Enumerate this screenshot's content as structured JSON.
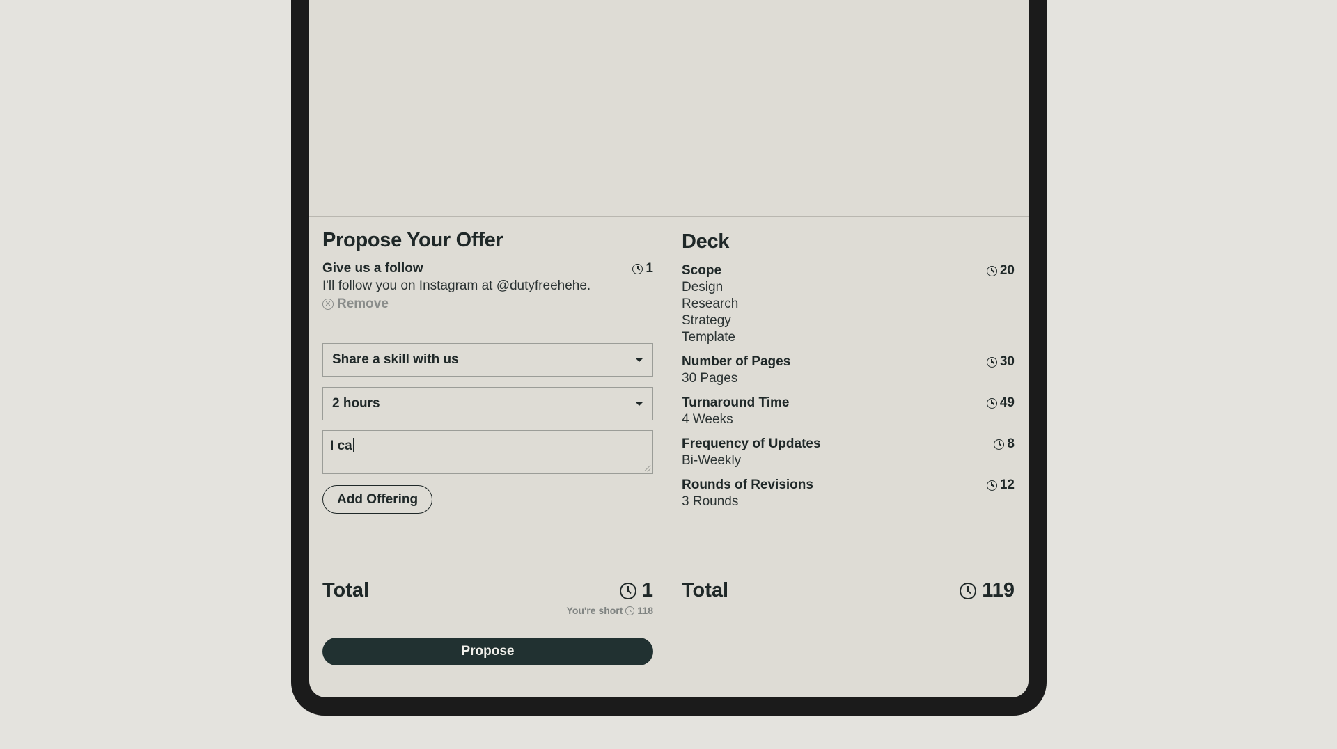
{
  "offer": {
    "title": "Propose Your Offer",
    "item": {
      "name": "Give us a follow",
      "hours": "1",
      "description": "I'll follow you on Instagram at @dutyfreehehe.",
      "remove_label": "Remove"
    },
    "skill_select": "Share a skill with us",
    "hours_select": "2 hours",
    "message_value": "I ca",
    "add_button": "Add Offering",
    "total_label": "Total",
    "total_value": "1",
    "short_label": "You're short",
    "short_value": "118",
    "propose_button": "Propose"
  },
  "deck": {
    "title": "Deck",
    "items": [
      {
        "name": "Scope",
        "hours": "20",
        "values": [
          "Design",
          "Research",
          "Strategy",
          "Template"
        ]
      },
      {
        "name": "Number of Pages",
        "hours": "30",
        "values": [
          "30 Pages"
        ]
      },
      {
        "name": "Turnaround Time",
        "hours": "49",
        "values": [
          "4 Weeks"
        ]
      },
      {
        "name": "Frequency of Updates",
        "hours": "8",
        "values": [
          "Bi-Weekly"
        ]
      },
      {
        "name": "Rounds of Revisions",
        "hours": "12",
        "values": [
          "3 Rounds"
        ]
      }
    ],
    "total_label": "Total",
    "total_value": "119"
  },
  "icons": {
    "clock": "clock-icon",
    "remove": "circle-x-icon",
    "caret": "caret-down-icon"
  },
  "colors": {
    "background": "#e4e3de",
    "panel": "#dedcd5",
    "primary_button": "#213131",
    "bezel": "#1b1b1b"
  }
}
